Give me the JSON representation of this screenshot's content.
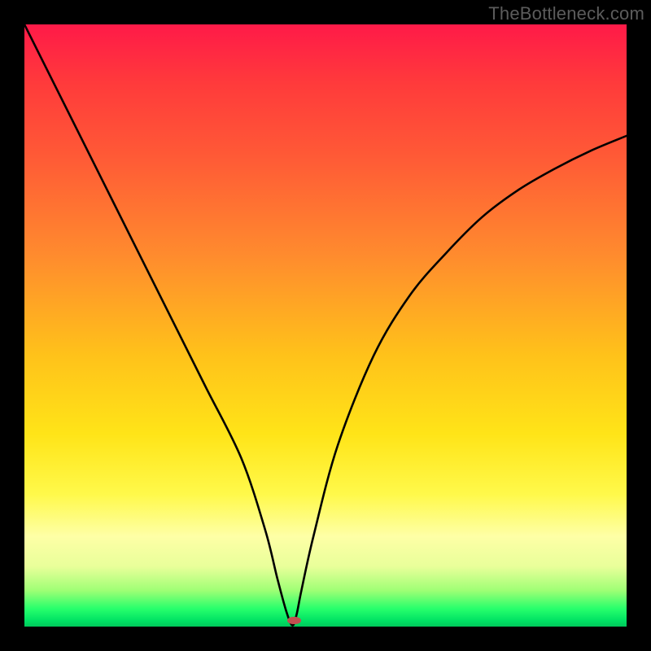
{
  "watermark": "TheBottleneck.com",
  "chart_data": {
    "type": "line",
    "title": "",
    "xlabel": "",
    "ylabel": "",
    "xlim": [
      0,
      100
    ],
    "ylim": [
      0,
      100
    ],
    "grid": false,
    "series": [
      {
        "name": "curve",
        "color": "#000000",
        "x": [
          0,
          6,
          12,
          18,
          24,
          30,
          36,
          40,
          42,
          43.5,
          44.5,
          45.2,
          46,
          48,
          52,
          58,
          64,
          70,
          76,
          82,
          88,
          94,
          100
        ],
        "y": [
          100,
          88,
          76,
          64,
          52,
          40,
          28,
          16,
          8,
          2.5,
          0.2,
          2,
          6,
          15,
          30,
          45,
          55,
          62,
          68,
          72.5,
          76,
          79,
          81.5
        ]
      }
    ],
    "marker": {
      "x": 44.8,
      "y": 1.0,
      "w": 2.2,
      "h": 1.3,
      "color": "#c05050"
    },
    "background_gradient": [
      {
        "stop": 0,
        "color": "#ff1a48"
      },
      {
        "stop": 55,
        "color": "#ffc21a"
      },
      {
        "stop": 85,
        "color": "#feffa6"
      },
      {
        "stop": 100,
        "color": "#00c85b"
      }
    ]
  }
}
